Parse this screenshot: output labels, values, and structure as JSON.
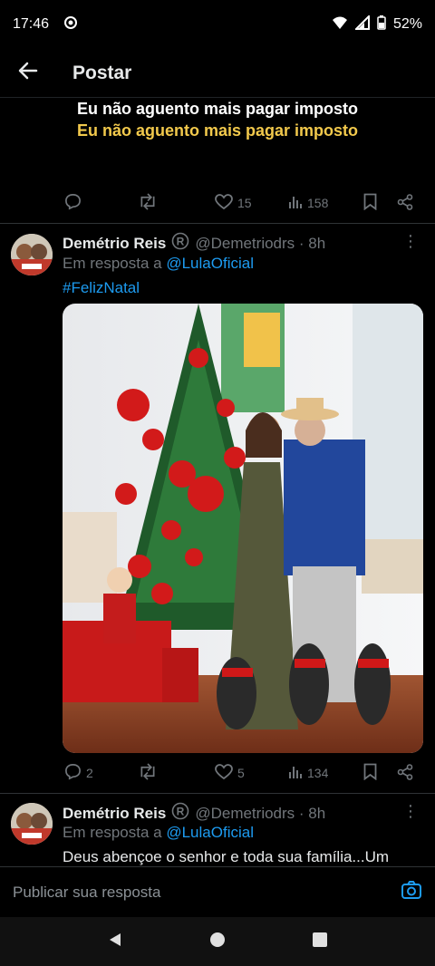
{
  "status": {
    "time": "17:46",
    "battery": "52%"
  },
  "appbar": {
    "title": "Postar"
  },
  "caption": {
    "line1": "Eu não aguento mais pagar imposto",
    "line2": "Eu não aguento mais pagar imposto"
  },
  "post_actions": {
    "replies": "",
    "likes": "15",
    "views": "158"
  },
  "reply1": {
    "name": "Demétrio Reis",
    "handle": "@Demetriodrs · 8h",
    "in_reply_prefix": "Em resposta a",
    "in_reply_to": "@LulaOficial",
    "hashtag": "#FelizNatal",
    "actions": {
      "replies": "2",
      "likes": "5",
      "views": "134"
    }
  },
  "reply2": {
    "name": "Demétrio Reis",
    "handle": "@Demetriodrs · 8h",
    "in_reply_prefix": "Em resposta a",
    "in_reply_to": "@LulaOficial",
    "text": "Deus abençoe o senhor e toda sua família...Um"
  },
  "reply_bar": {
    "placeholder": "Publicar sua resposta"
  },
  "icons": [
    "settings-dot-icon",
    "wifi-icon",
    "signal-icon",
    "battery-icon",
    "back-arrow-icon",
    "reply-icon",
    "retweet-icon",
    "heart-icon",
    "views-icon",
    "bookmark-icon",
    "share-icon",
    "verified-r-icon",
    "more-icon",
    "camera-icon",
    "nav-back-icon",
    "nav-home-icon",
    "nav-recents-icon"
  ],
  "colors": {
    "accent": "#1d9bf0",
    "caption_yellow": "#f2c94c",
    "muted": "#71767b"
  }
}
